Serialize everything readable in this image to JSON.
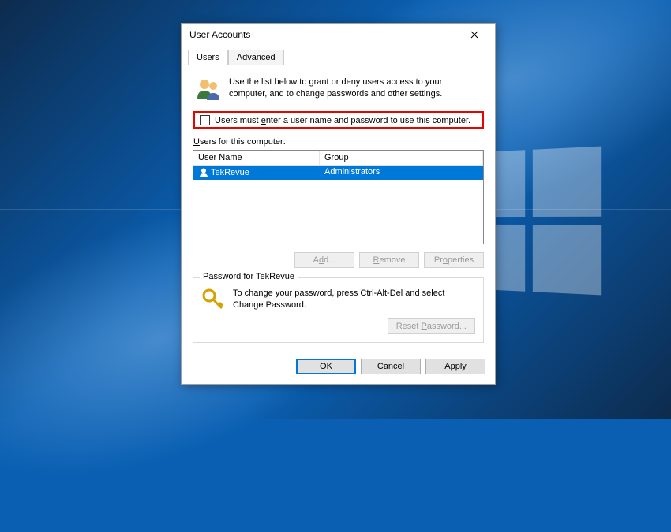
{
  "window": {
    "title": "User Accounts"
  },
  "tabs": {
    "users": "Users",
    "advanced": "Advanced"
  },
  "intro": "Use the list below to grant or deny users access to your computer, and to change passwords and other settings.",
  "checkbox": {
    "pre": "Users must ",
    "u": "e",
    "post": "nter a user name and password to use this computer."
  },
  "list": {
    "label_pre": "",
    "label_u": "U",
    "label_post": "sers for this computer:",
    "col_name": "User Name",
    "col_group": "Group",
    "rows": [
      {
        "name": "TekRevue",
        "group": "Administrators"
      }
    ]
  },
  "buttons": {
    "add_pre": "A",
    "add_u": "d",
    "add_post": "d...",
    "remove_pre": "",
    "remove_u": "R",
    "remove_post": "emove",
    "props_pre": "Pr",
    "props_u": "o",
    "props_post": "perties"
  },
  "password_group": {
    "title": "Password for TekRevue",
    "text": "To change your password, press Ctrl-Alt-Del and select Change Password.",
    "reset_pre": "Reset ",
    "reset_u": "P",
    "reset_post": "assword..."
  },
  "dialog_buttons": {
    "ok": "OK",
    "cancel": "Cancel",
    "apply_pre": "",
    "apply_u": "A",
    "apply_post": "pply"
  }
}
